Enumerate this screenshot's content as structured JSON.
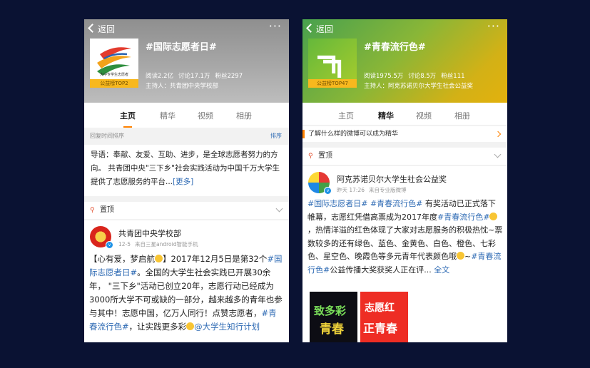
{
  "left": {
    "back_label": "返回",
    "more": "···",
    "topic_title": "#国际志愿者日#",
    "thumb_caption": "大中专学生志愿者",
    "rank_badge": "公益榜TOP2",
    "stats": {
      "read": "阅读2.2亿",
      "discuss": "讨论17.1万",
      "fans": "粉丝2297"
    },
    "host": "主持人：共青团中央学校部",
    "tabs": [
      "主页",
      "精华",
      "视频",
      "相册"
    ],
    "active_tab": "主页",
    "sort_label": "回复时间排序",
    "sort_action": "排序",
    "intro_text": "导语：奉献、友爱、互助、进步，是全球志愿者努力的方向。 共青团中央\"三下乡\"社会实践活动为中国千万大学生提供了志愿服务的平台...",
    "intro_more": "[更多]",
    "pinned_label": "置顶",
    "post": {
      "author": "共青团中央学校部",
      "date": "12-5",
      "source": "来自三星android智能手机",
      "t1": "【心有爱，梦启航",
      "t2": "】2017年12月5日是第32个",
      "tag1": "#国际志愿者日#",
      "t3": "。全国的大学生社会实践已开展30余年， \"三下乡\"活动已创立20年，志愿行动已经成为3000所大学不可或缺的一部分，越来越多的青年也参与其中！志愿中国，亿万人同行！点赞志愿者，",
      "tag2": "#青春流行色#",
      "t4": "，让实践更多彩",
      "mention": "@大学生知行计划"
    }
  },
  "right": {
    "back_label": "返回",
    "more": "···",
    "topic_title": "#青春流行色#",
    "rank_badge": "公益榜TOP47",
    "stats": {
      "read": "阅读1975.5万",
      "discuss": "讨论8.5万",
      "fans": "粉丝111"
    },
    "host": "主持人：阿克苏诺贝尔大学生社会公益奖",
    "tabs": [
      "主页",
      "精华",
      "视频",
      "相册"
    ],
    "active_tab": "精华",
    "essence_banner": "了解什么样的微博可以成为精华",
    "pinned_label": "置顶",
    "post": {
      "author": "阿克苏诺贝尔大学生社会公益奖",
      "date": "昨天 17:26",
      "source": "来自专业版微博",
      "tag1": "#国际志愿者日#",
      "tag2": "#青春流行色#",
      "t1": "有奖活动已正式落下帷幕，志愿红凭借高票成为2017年度",
      "tag3": "#青春流行色#",
      "t2": "，热情洋溢的红色体现了大家对志愿服务的积极热忱~票数较多的还有绿色、蓝色、金黄色、白色、橙色、七彩色、星空色、晚霞色等多元青年代表颜色哦",
      "t3": "~",
      "tag4": "#青春流行色#",
      "t4": "公益传播大奖获奖人正在评...",
      "full_text": "全文"
    },
    "poster1": {
      "title": "致多彩",
      "subtitle": "青春"
    },
    "poster2": {
      "title": "志愿红",
      "subtitle": "正青春"
    }
  },
  "colors": {
    "accent": "#ff8200",
    "link": "#2f6bb4",
    "background": "#0a1233"
  }
}
